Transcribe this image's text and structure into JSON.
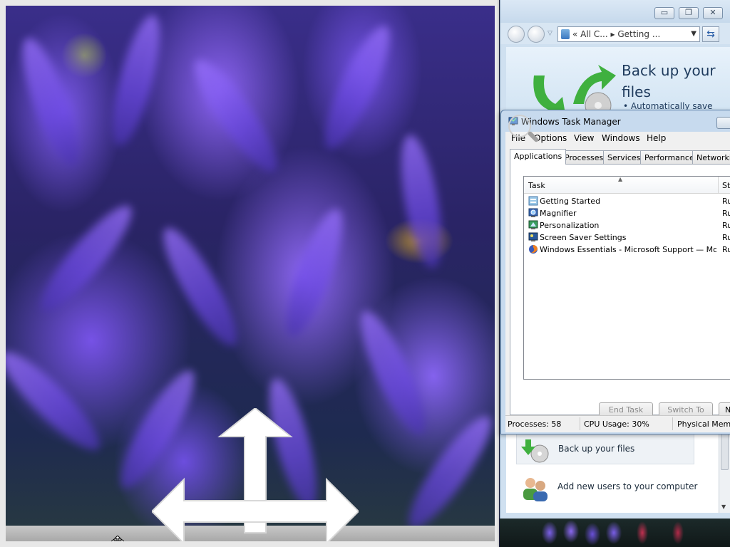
{
  "control_panel": {
    "address_back": "«",
    "address_part1": "All C...",
    "address_sep": "▸",
    "address_part2": "Getting ...",
    "banner_title": "Back up your files",
    "banner_bullet": "• Automatically save",
    "items": [
      {
        "label": "Back up your files",
        "icon": "backup-icon"
      },
      {
        "label": "Add new users to your computer",
        "icon": "users-icon"
      }
    ]
  },
  "task_manager": {
    "title": "Windows Task Manager",
    "menu": [
      "File",
      "Options",
      "View",
      "Windows",
      "Help"
    ],
    "tabs": [
      "Applications",
      "Processes",
      "Services",
      "Performance",
      "Networking"
    ],
    "active_tab": "Applications",
    "columns": {
      "task": "Task",
      "status": "Sta"
    },
    "rows": [
      {
        "name": "Getting Started",
        "status": "Ru",
        "icon": "getting-started-icon"
      },
      {
        "name": "Magnifier",
        "status": "Ru",
        "icon": "magnifier-icon"
      },
      {
        "name": "Personalization",
        "status": "Ru",
        "icon": "personalization-icon"
      },
      {
        "name": "Screen Saver Settings",
        "status": "Ru",
        "icon": "screensaver-icon"
      },
      {
        "name": "Windows Essentials - Microsoft Support — Mozill...",
        "status": "Ru",
        "icon": "firefox-icon"
      }
    ],
    "buttons": {
      "end_task": "End Task",
      "switch_to": "Switch To",
      "new_task": "Ne"
    },
    "status": {
      "processes": "Processes: 58",
      "cpu": "CPU Usage: 30%",
      "memory": "Physical Mem"
    }
  },
  "colors": {
    "title_bar": "#c7daee",
    "flower_purple": "#7a58e8"
  }
}
